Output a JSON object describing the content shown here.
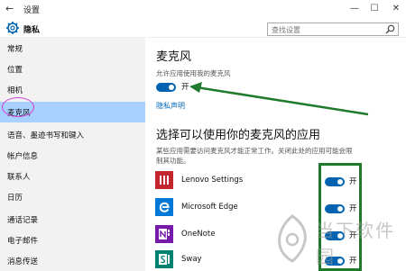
{
  "window": {
    "title": "设置",
    "min_glyph": "—",
    "max_glyph": "☐",
    "close_glyph": "✕",
    "back_glyph": "←"
  },
  "header": {
    "heading": "隐私",
    "search_placeholder": "查找设置"
  },
  "sidebar": {
    "items": [
      {
        "label": "常规"
      },
      {
        "label": "位置"
      },
      {
        "label": "相机"
      },
      {
        "label": "麦克风",
        "active": true
      },
      {
        "label": "语音、墨迹书写和键入"
      },
      {
        "label": "帐户信息"
      },
      {
        "label": "联系人"
      },
      {
        "label": "日历"
      },
      {
        "label": "通话记录"
      },
      {
        "label": "电子邮件"
      },
      {
        "label": "消息传送"
      }
    ]
  },
  "main": {
    "mic_title": "麦克风",
    "allow_label": "允许应用使用我的麦克风",
    "allow_state": "开",
    "privacy_link": "隐私声明",
    "choose_title": "选择可以使用你的麦克风的应用",
    "desc_line1": "某些应用需要访问麦克风才能正常工作。关闭此处的应用可能会限",
    "desc_line2": "制其功能。",
    "apps": [
      {
        "name": "Lenovo Settings",
        "state": "开",
        "icon": "lenovo-settings-icon",
        "color": "#c4262e"
      },
      {
        "name": "Microsoft Edge",
        "state": "开",
        "icon": "edge-icon",
        "color": "#0078d7"
      },
      {
        "name": "OneNote",
        "state": "开",
        "icon": "onenote-icon",
        "color": "#7719aa"
      },
      {
        "name": "Sway",
        "state": "开",
        "icon": "sway-icon",
        "color": "#008272"
      }
    ]
  },
  "colors": {
    "accent": "#0063b1",
    "annotation_green": "#1f7a2c",
    "annotation_pink": "#d23cd6",
    "sidebar_active": "#a9d1ff"
  },
  "watermark": {
    "text": "当下软件园"
  }
}
